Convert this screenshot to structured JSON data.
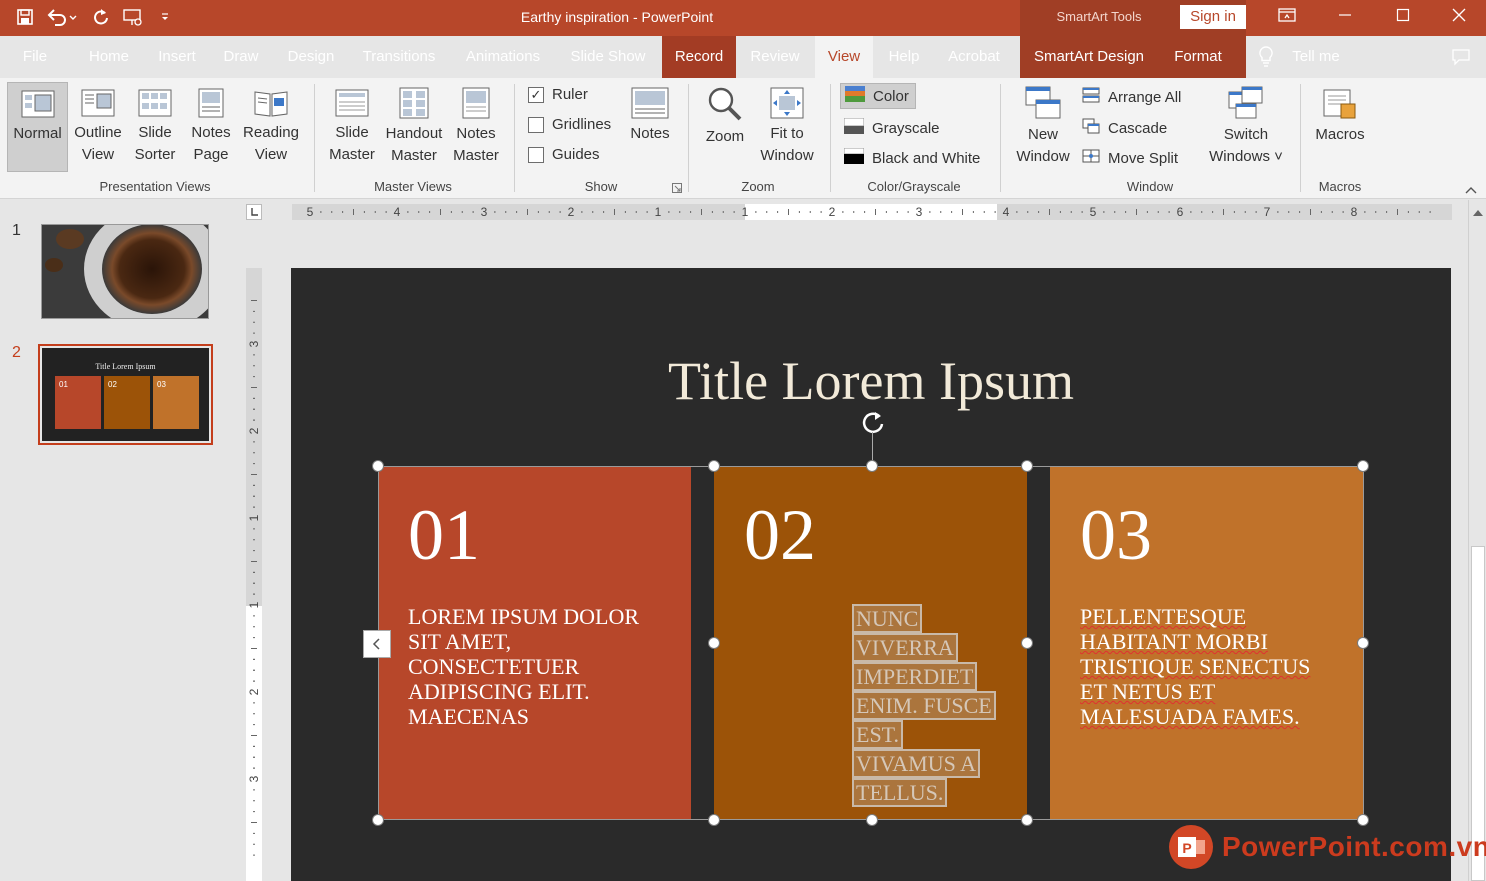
{
  "window": {
    "title": "Earthy inspiration  -  PowerPoint",
    "context_label": "SmartArt Tools",
    "sign_in": "Sign in"
  },
  "tabs": [
    "File",
    "Home",
    "Insert",
    "Draw",
    "Design",
    "Transitions",
    "Animations",
    "Slide Show",
    "Record",
    "Review",
    "View",
    "Help",
    "Acrobat",
    "SmartArt Design",
    "Format",
    "Tell me"
  ],
  "active_tab": "View",
  "ribbon": {
    "presentation_views": {
      "label": "Presentation Views",
      "normal": [
        "Normal"
      ],
      "outline": [
        "Outline",
        "View"
      ],
      "slide_sorter": [
        "Slide",
        "Sorter"
      ],
      "notes_page": [
        "Notes",
        "Page"
      ],
      "reading_view": [
        "Reading",
        "View"
      ]
    },
    "master_views": {
      "label": "Master Views",
      "slide_master": [
        "Slide",
        "Master"
      ],
      "handout_master": [
        "Handout",
        "Master"
      ],
      "notes_master": [
        "Notes",
        "Master"
      ]
    },
    "show": {
      "label": "Show",
      "ruler": "Ruler",
      "ruler_checked": true,
      "gridlines": "Gridlines",
      "guides": "Guides",
      "notes": "Notes"
    },
    "zoom": {
      "label": "Zoom",
      "zoom": "Zoom",
      "fit_to_window": [
        "Fit to",
        "Window"
      ]
    },
    "color": {
      "label": "Color/Grayscale",
      "color": "Color",
      "grayscale": "Grayscale",
      "black_white": "Black and White"
    },
    "window": {
      "label": "Window",
      "new_window": [
        "New",
        "Window"
      ],
      "arrange_all": "Arrange All",
      "cascade": "Cascade",
      "move_split": "Move Split",
      "switch_windows": [
        "Switch",
        "Windows ˅"
      ]
    },
    "macros": {
      "label": "Macros",
      "macros": "Macros"
    }
  },
  "ruler": {
    "h_ticks": [
      "5",
      "4",
      "3",
      "2",
      "1",
      "1",
      "2",
      "3",
      "4",
      "5",
      "6",
      "7",
      "8"
    ],
    "v_ticks": [
      "3",
      "2",
      "1",
      "1",
      "2",
      "3"
    ]
  },
  "thumbnails": [
    {
      "number": "1"
    },
    {
      "number": "2",
      "title": "Title Lorem Ipsum",
      "cards": [
        "01",
        "02",
        "03"
      ]
    }
  ],
  "slide": {
    "title": "Title Lorem Ipsum",
    "cards": [
      {
        "number": "01",
        "lines": [
          "LOREM IPSUM DOLOR",
          "SIT AMET,",
          "CONSECTETUER",
          "ADIPISCING ELIT.",
          "MAECENAS"
        ],
        "color": "#b7472a"
      },
      {
        "number": "02",
        "lines": [
          "NUNC",
          "VIVERRA",
          "IMPERDIET",
          "ENIM. FUSCE",
          "EST.",
          "VIVAMUS A",
          "TELLUS."
        ],
        "color": "#9c5308"
      },
      {
        "number": "03",
        "lines": [
          "PELLENTESQUE",
          "HABITANT MORBI",
          "TRISTIQUE SENECTUS",
          "ET NETUS ET",
          "MALESUADA FAMES."
        ],
        "color": "#c0722a"
      }
    ]
  },
  "watermark": "PowerPoint.com.vn"
}
